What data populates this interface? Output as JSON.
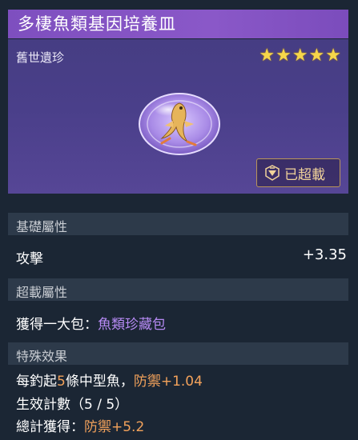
{
  "item": {
    "title": "多棲魚類基因培養皿",
    "rarity": "舊世遺珍",
    "stars": "★★★★★",
    "star_rating": 5,
    "badge_label": "已超載"
  },
  "sections": {
    "base": {
      "heading": "基礎屬性",
      "stat_label": "攻擊",
      "stat_value": "+3.35"
    },
    "overload": {
      "heading": "超載屬性",
      "label": "獲得一大包：",
      "reward": "魚類珍藏包"
    },
    "special": {
      "heading": "特殊效果",
      "line1_a": "每釣起",
      "line1_count": "5",
      "line1_b": "條中型魚，",
      "line1_stat": "防禦",
      "line1_value": "+1.04",
      "line2": "生效計數（5 / 5）",
      "line3_a": "總計獲得：",
      "line3_stat": "防禦",
      "line3_value": "+5.2"
    }
  },
  "colors": {
    "header": "#8a58c8",
    "banner": "#4a3f8a",
    "star": "#f6d64a",
    "reward_purple": "#b68af4",
    "value_orange": "#f3a25b"
  }
}
